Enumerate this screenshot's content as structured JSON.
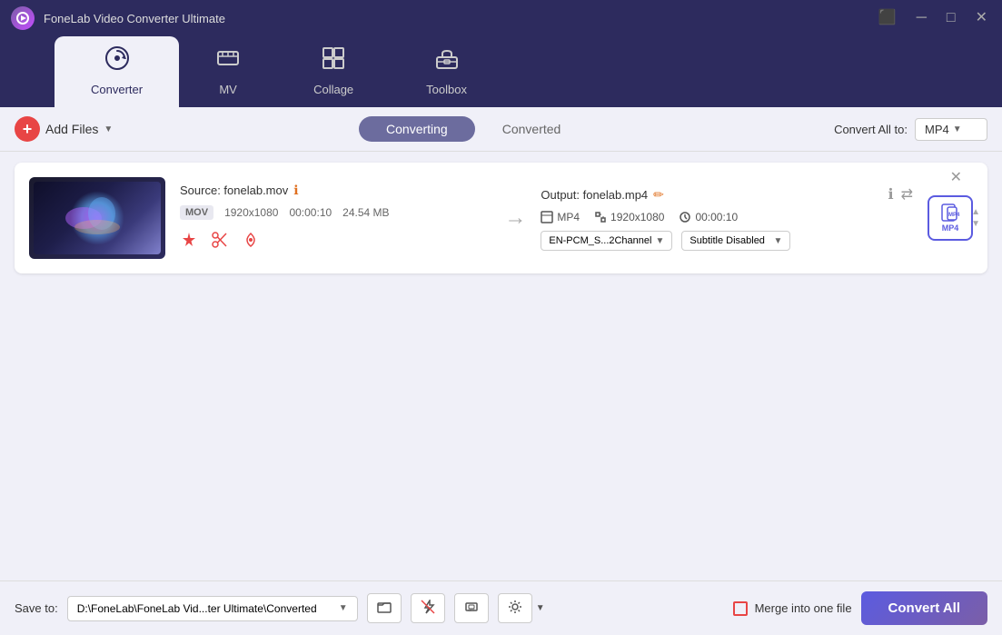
{
  "app": {
    "title": "FoneLab Video Converter Ultimate"
  },
  "titlebar": {
    "captions_btn": "⬛",
    "minimize_btn": "─",
    "maximize_btn": "□",
    "close_btn": "✕"
  },
  "nav": {
    "tabs": [
      {
        "id": "converter",
        "label": "Converter",
        "icon": "⟳",
        "active": true
      },
      {
        "id": "mv",
        "label": "MV",
        "icon": "📺",
        "active": false
      },
      {
        "id": "collage",
        "label": "Collage",
        "icon": "⊞",
        "active": false
      },
      {
        "id": "toolbox",
        "label": "Toolbox",
        "icon": "🧰",
        "active": false
      }
    ]
  },
  "toolbar": {
    "add_files_label": "Add Files",
    "tabs": [
      {
        "id": "converting",
        "label": "Converting",
        "active": true
      },
      {
        "id": "converted",
        "label": "Converted",
        "active": false
      }
    ],
    "convert_all_to_label": "Convert All to:",
    "format": "MP4"
  },
  "file_item": {
    "source_label": "Source: fonelab.mov",
    "format": "MOV",
    "resolution": "1920x1080",
    "duration": "00:00:10",
    "size": "24.54 MB",
    "output_label": "Output: fonelab.mp4",
    "output_format": "MP4",
    "output_resolution": "1920x1080",
    "output_duration": "00:00:10",
    "audio_track": "EN-PCM_S...2Channel",
    "subtitle": "Subtitle Disabled"
  },
  "footer": {
    "save_to_label": "Save to:",
    "save_path": "D:\\FoneLab\\FoneLab Vid...ter Ultimate\\Converted",
    "merge_label": "Merge into one file",
    "convert_all_btn": "Convert All"
  }
}
